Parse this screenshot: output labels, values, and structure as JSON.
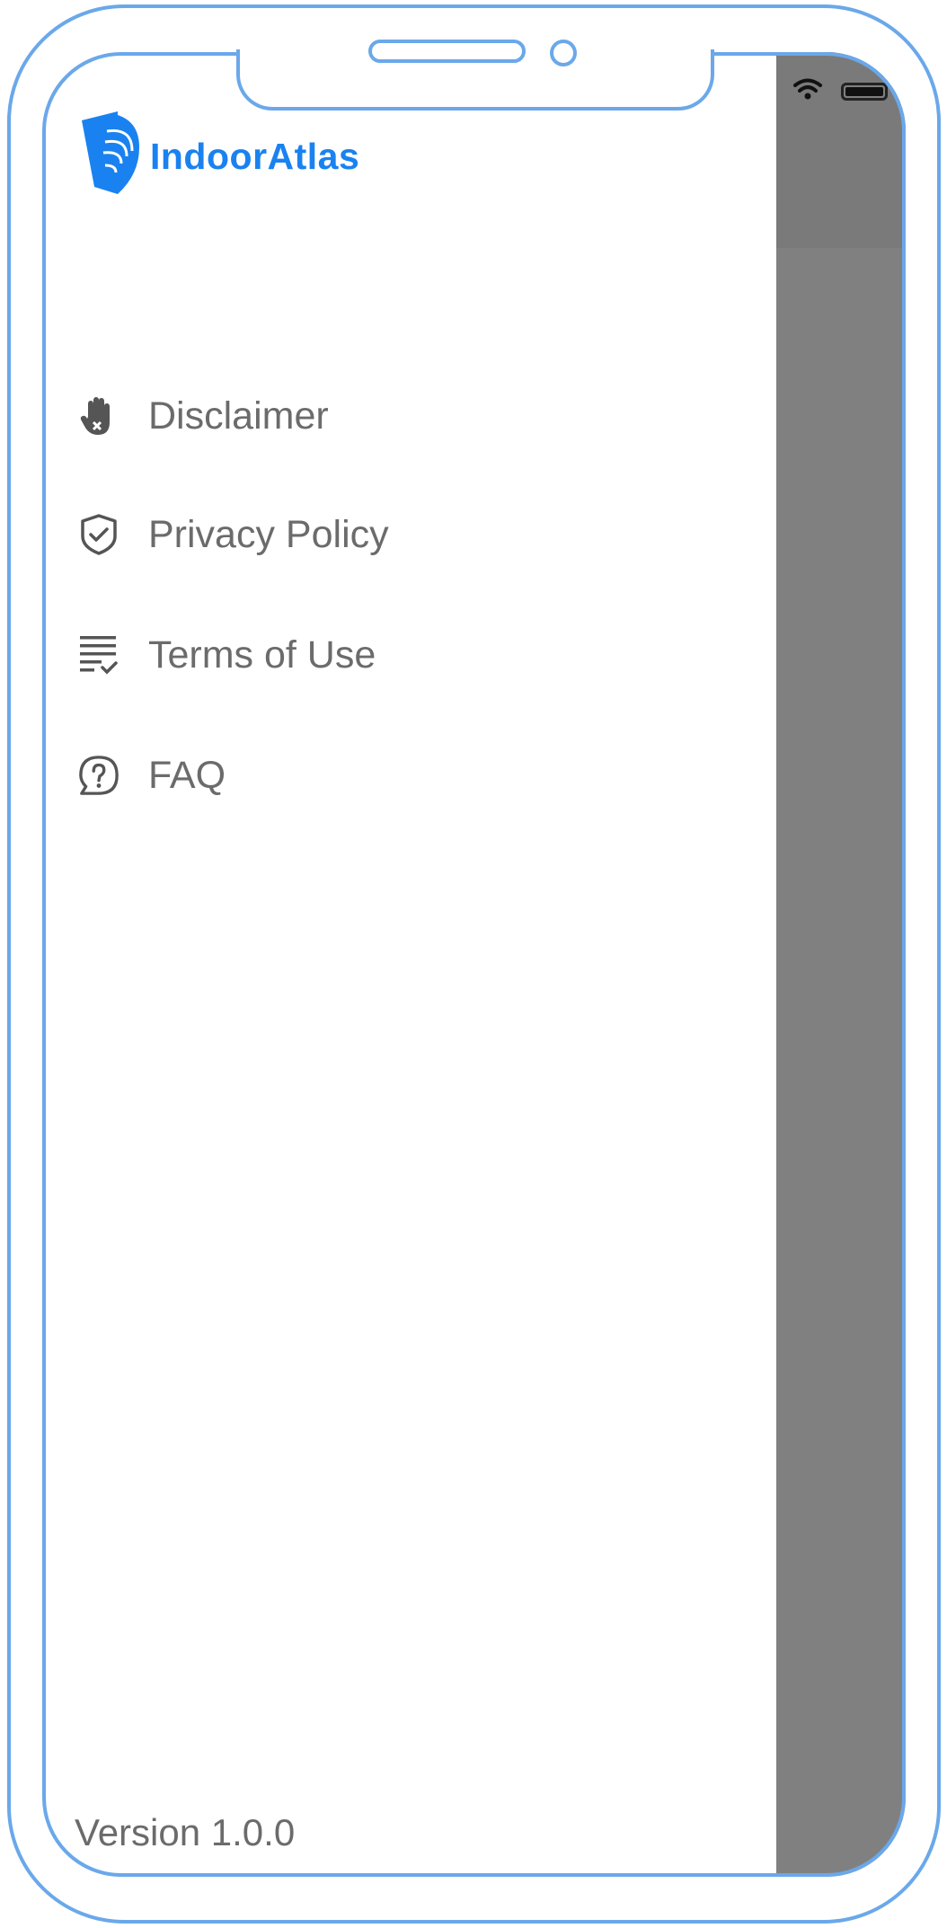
{
  "brand": {
    "name": "IndoorAtlas",
    "logo_icon": "indooratlas-logo-icon",
    "color": "#1a82f0"
  },
  "status_bar": {
    "icons": [
      "wifi-icon",
      "battery-icon"
    ]
  },
  "drawer": {
    "menu": [
      {
        "label": "Disclaimer",
        "icon": "hand-stop-icon"
      },
      {
        "label": "Privacy Policy",
        "icon": "shield-check-icon"
      },
      {
        "label": "Terms of Use",
        "icon": "list-check-icon"
      },
      {
        "label": "FAQ",
        "icon": "question-bubble-icon"
      }
    ],
    "version": "Version 1.0.0"
  },
  "colors": {
    "frame": "#6aa8ea",
    "overlay": "#808080",
    "menu_text": "#6b6b6b"
  }
}
